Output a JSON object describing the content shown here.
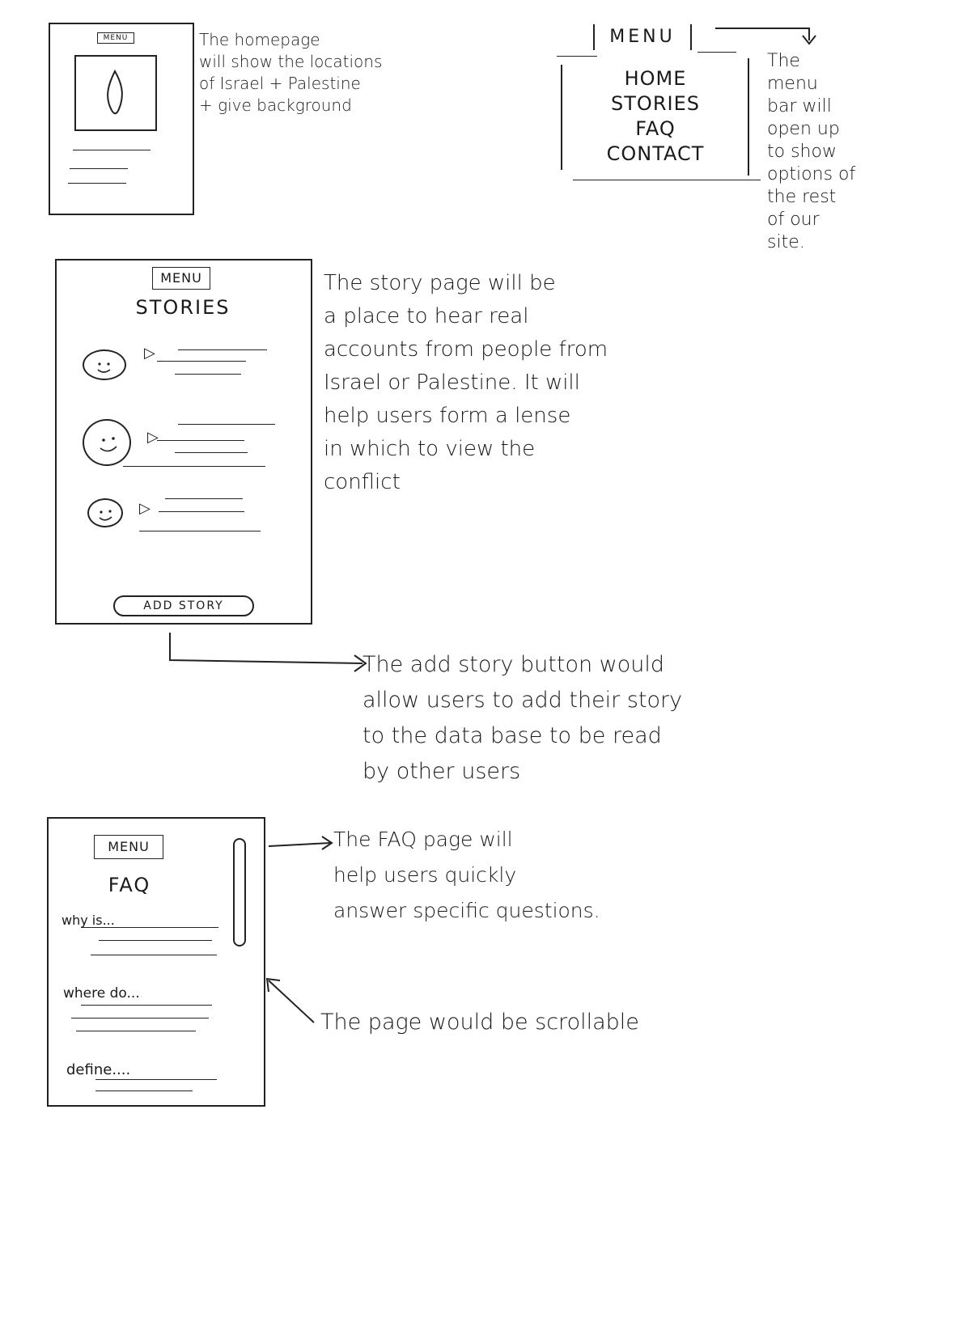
{
  "home_sketch": {
    "menu_label": "MENU",
    "note": "The homepage\nwill show the locations\nof Israel + Palestine\n+ give background"
  },
  "menu_sketch": {
    "menu_label": "MENU",
    "items": [
      "HOME",
      "STORIES",
      "FAQ",
      "CONTACT"
    ],
    "note": "The\nmenu\nbar will\nopen up\nto show\noptions of\nthe rest\nof our\nsite."
  },
  "stories_sketch": {
    "menu_label": "MENU",
    "title": "STORIES",
    "button_label": "ADD STORY",
    "note": "The story page will be\na place to hear real\naccounts from people from\nIsrael or Palestine. It will\nhelp users form a lense\nin which to view the\nconflict",
    "button_note": "The add story button would\nallow users to add their story\nto the data base to be read\nby other users"
  },
  "faq_sketch": {
    "menu_label": "MENU",
    "title": "FAQ",
    "questions": [
      "why is...",
      "where do...",
      "define...."
    ],
    "note": "The FAQ page will\nhelp users quickly\nanswer specific questions.",
    "scroll_note": "The page would be scrollable"
  },
  "colors": {
    "ink": "#1a1a1a",
    "paper": "#ffffff",
    "wash": "#dfe8e4"
  }
}
